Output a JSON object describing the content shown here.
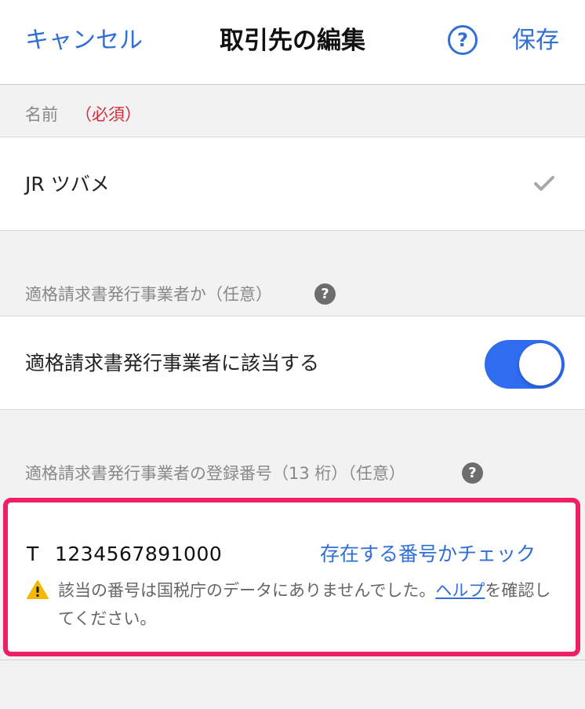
{
  "header": {
    "cancel_label": "キャンセル",
    "title": "取引先の編集",
    "help_glyph": "?",
    "save_label": "保存"
  },
  "name_section": {
    "label": "名前",
    "required_label": "（必須）",
    "value": "JR ツバメ",
    "check_icon": "checkmark-icon"
  },
  "qualified_section": {
    "label": "適格請求書発行事業者か（任意）",
    "help_glyph": "?",
    "toggle_label": "適格請求書発行事業者に該当する",
    "toggle_on": true,
    "toggle_color": "#2f6cf0"
  },
  "registration_section": {
    "label": "適格請求書発行事業者の登録番号（13 桁）（任意）",
    "help_glyph": "?",
    "prefix": "T",
    "number": "1234567891000",
    "check_link": "存在する番号かチェック",
    "warning_before": "該当の番号は国税庁のデータにありませんでした。",
    "warning_link": "ヘルプ",
    "warning_after": "を確認してください。",
    "highlight_color": "#ef1f66"
  }
}
